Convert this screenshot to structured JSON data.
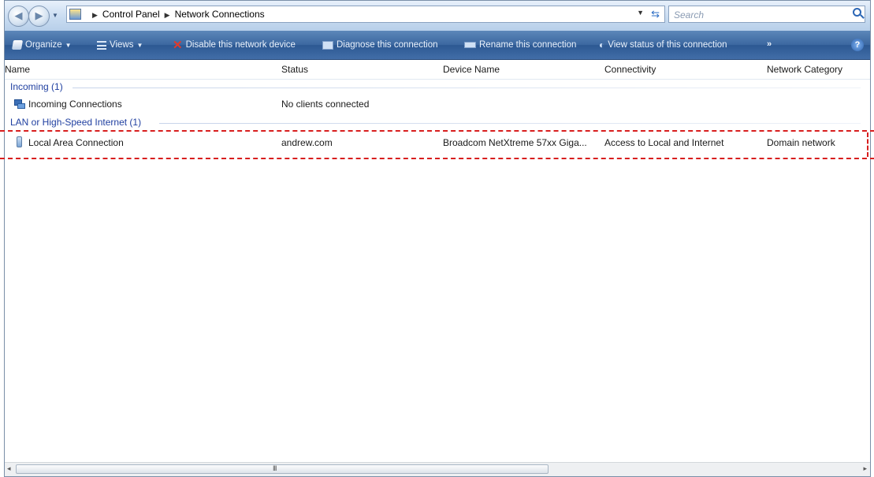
{
  "address_bar": {
    "breadcrumbs": [
      "Control Panel",
      "Network Connections"
    ],
    "search_placeholder": "Search"
  },
  "toolbar": {
    "organize": "Organize",
    "views": "Views",
    "disable": "Disable this network device",
    "diagnose": "Diagnose this connection",
    "rename": "Rename this connection",
    "view_status": "View status of this connection",
    "more": "»",
    "help": "?"
  },
  "columns": [
    "Name",
    "Status",
    "Device Name",
    "Connectivity",
    "Network Category"
  ],
  "groups": [
    {
      "label": "Incoming (1)",
      "items": [
        {
          "name": "Incoming Connections",
          "status": "No clients connected",
          "device": "",
          "connectivity": "",
          "category": ""
        }
      ]
    },
    {
      "label": "LAN or High-Speed Internet (1)",
      "items": [
        {
          "name": "Local Area Connection",
          "status": "andrew.com",
          "device": "Broadcom NetXtreme 57xx Giga...",
          "connectivity": "Access to Local and Internet",
          "category": "Domain network"
        }
      ]
    }
  ],
  "scrollbar": {
    "left_arrow": "◂",
    "right_arrow": "▸",
    "grip": "III"
  },
  "colors": {
    "command_bar": "#3b67a0",
    "group_header": "#1f3fa0",
    "highlight": "#d81e1e"
  }
}
